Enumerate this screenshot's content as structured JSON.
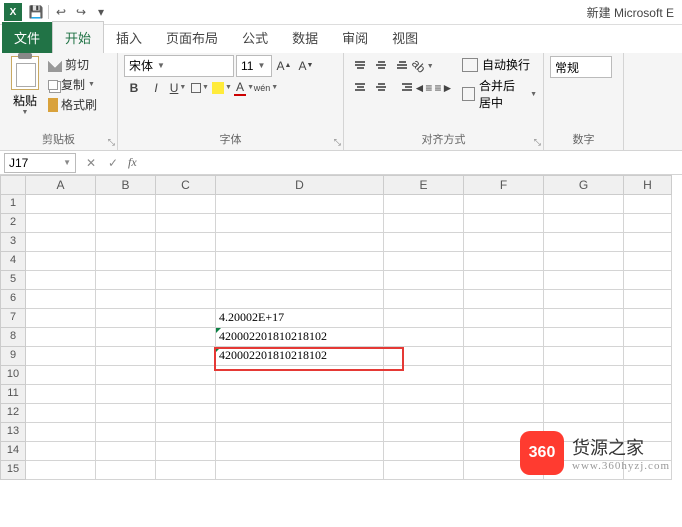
{
  "title": "新建 Microsoft E",
  "qat": {
    "save": "💾",
    "undo": "↩",
    "redo": "↪"
  },
  "tabs": {
    "file": "文件",
    "home": "开始",
    "insert": "插入",
    "layout": "页面布局",
    "formulas": "公式",
    "data": "数据",
    "review": "审阅",
    "view": "视图"
  },
  "ribbon": {
    "clipboard": {
      "paste": "粘贴",
      "cut": "剪切",
      "copy": "复制",
      "format_painter": "格式刷",
      "label": "剪贴板"
    },
    "font": {
      "name": "宋体",
      "size": "11",
      "label": "字体",
      "bold": "B",
      "italic": "I",
      "underline": "U",
      "font_a": "A",
      "wen": "wén"
    },
    "align": {
      "label": "对齐方式",
      "wrap": "自动换行",
      "merge": "合并后居中"
    },
    "number": {
      "label": "数字",
      "format": "常规"
    }
  },
  "namebox": "J17",
  "formula": "",
  "cols": [
    "A",
    "B",
    "C",
    "D",
    "E",
    "F",
    "G",
    "H"
  ],
  "rows": [
    "1",
    "2",
    "3",
    "4",
    "5",
    "6",
    "7",
    "8",
    "9",
    "10",
    "11",
    "12",
    "13",
    "14",
    "15"
  ],
  "cells": {
    "D7": "4.20002E+17",
    "D8": "420002201810218102",
    "D9": "420002201810218102"
  },
  "watermark": {
    "badge": "360",
    "title": "货源之家",
    "url": "www.360hyzj.com"
  }
}
